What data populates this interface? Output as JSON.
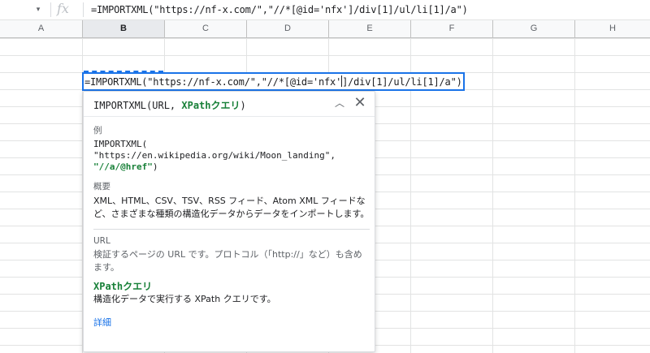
{
  "formula_bar": {
    "name_box_dropdown": "▾",
    "fx_label": "fx",
    "formula": "=IMPORTXML(\"https://nf-x.com/\",\"//*[@id='nfx']/div[1]/ul/li[1]/a\")"
  },
  "columns": [
    "A",
    "B",
    "C",
    "D",
    "E",
    "F",
    "G",
    "H"
  ],
  "active_column": "B",
  "cell": {
    "text_before_caret": "=IMPORTXML(\"https://nf-x.com/\",\"//*[@id='nfx'",
    "text_after_caret": "]/div[1]/ul/li[1]/a\")"
  },
  "help": {
    "sig_prefix": "IMPORTXML(URL, ",
    "sig_highlight": "XPathクエリ",
    "sig_suffix": ")",
    "collapse_icon": "︿",
    "close_icon": "✕",
    "example_label": "例",
    "example_line1": "IMPORTXML(",
    "example_line2": "\"https://en.wikipedia.org/wiki/Moon_landing\",",
    "example_line3_hl": "\"//a/@href\"",
    "example_line3_end": ")",
    "summary_label": "概要",
    "summary_text": "XML、HTML、CSV、TSV、RSS フィード、Atom XML フィードなど、さまざまな種類の構造化データからデータをインポートします。",
    "param1_name": "URL",
    "param1_desc": "検証するページの URL です。プロトコル（「http://」など）も含めます。",
    "param2_name": "XPathクエリ",
    "param2_desc": "構造化データで実行する XPath クエリです。",
    "more_link": "詳細"
  }
}
